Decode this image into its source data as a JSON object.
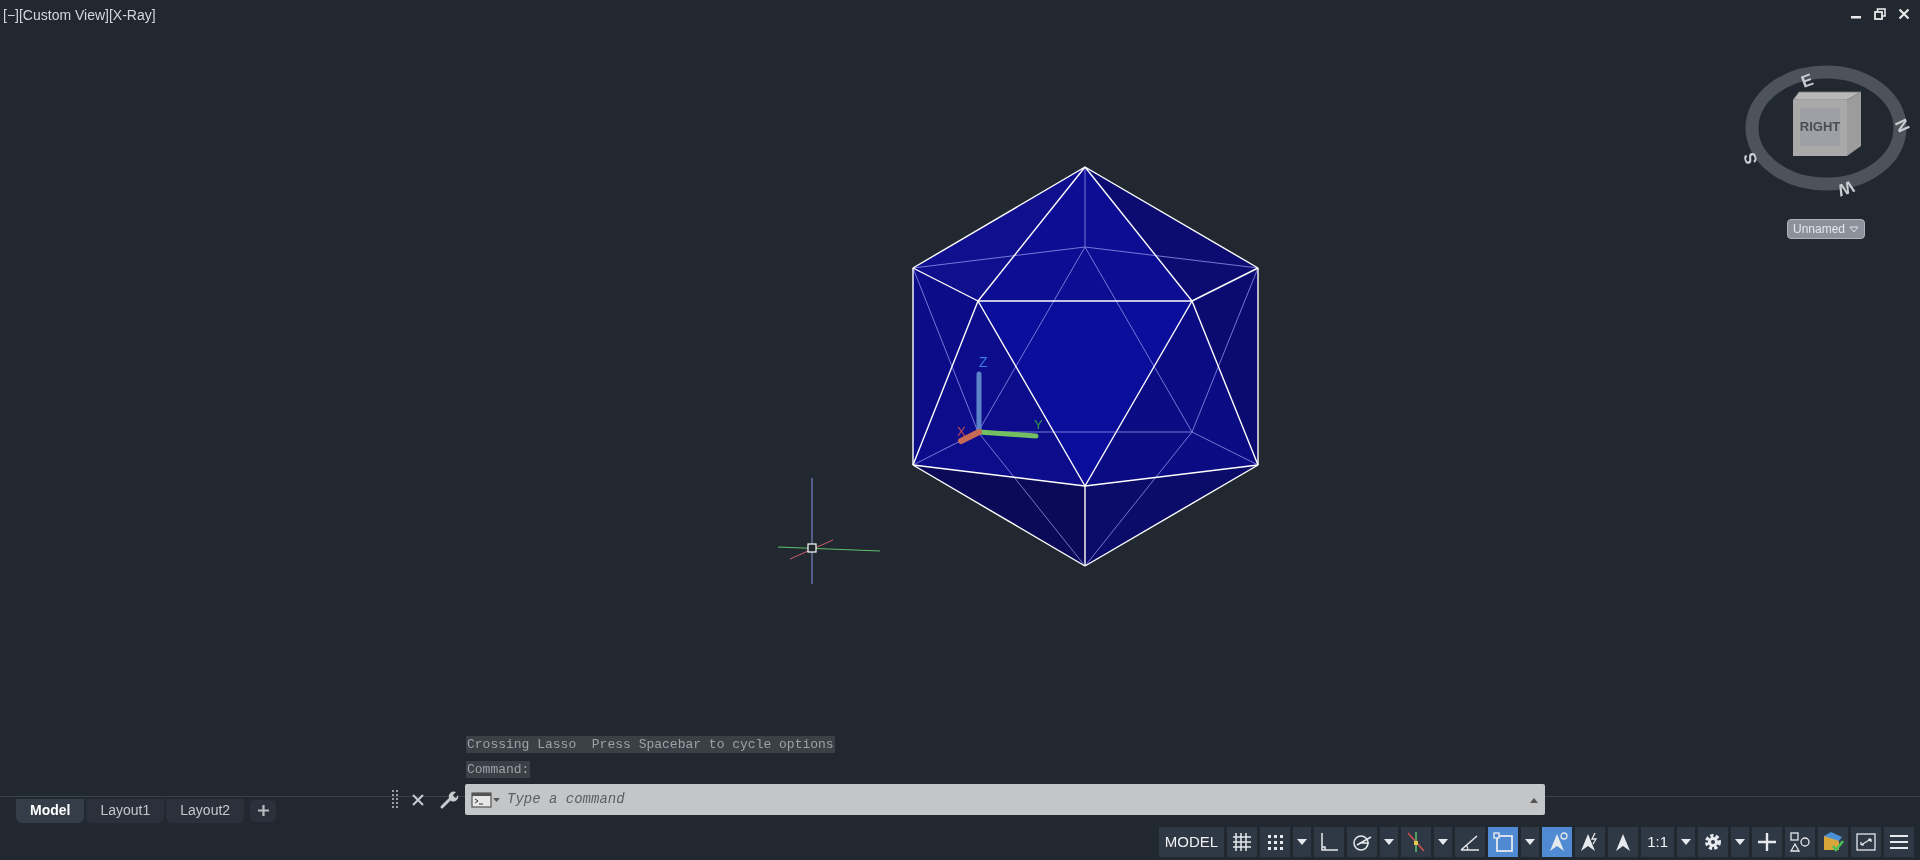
{
  "viewport": {
    "label": "[−][Custom View][X-Ray]"
  },
  "viewcube": {
    "face": "RIGHT",
    "compass": [
      "E",
      "N",
      "W",
      "S"
    ],
    "view_menu": "Unnamed"
  },
  "ucs": {
    "axes": [
      "Z",
      "Y",
      "X"
    ]
  },
  "command_line": {
    "history": [
      "Crossing Lasso  Press Spacebar to cycle options",
      "Command:"
    ],
    "placeholder": "Type a command"
  },
  "layout_tabs": [
    {
      "label": "Model",
      "selected": true
    },
    {
      "label": "Layout1",
      "selected": false
    },
    {
      "label": "Layout2",
      "selected": false
    }
  ],
  "status_bar": [
    {
      "kind": "text",
      "label": "MODEL",
      "on": false
    },
    {
      "kind": "grid",
      "on": false
    },
    {
      "kind": "snap",
      "on": false
    },
    {
      "kind": "caret",
      "on": false
    },
    {
      "kind": "ortho",
      "on": false
    },
    {
      "kind": "polar",
      "on": false
    },
    {
      "kind": "caret",
      "on": false
    },
    {
      "kind": "tracking",
      "on": false
    },
    {
      "kind": "caret",
      "on": false
    },
    {
      "kind": "angle",
      "on": false
    },
    {
      "kind": "osnap",
      "on": true
    },
    {
      "kind": "caret",
      "on": false
    },
    {
      "kind": "annotation",
      "on": true
    },
    {
      "kind": "autoscale",
      "on": false
    },
    {
      "kind": "annoscale",
      "on": false
    },
    {
      "kind": "text",
      "label": "1:1",
      "on": false
    },
    {
      "kind": "caret",
      "on": false
    },
    {
      "kind": "gear",
      "on": false
    },
    {
      "kind": "caret",
      "on": false
    },
    {
      "kind": "plus",
      "on": false
    },
    {
      "kind": "isolate",
      "on": false
    },
    {
      "kind": "hardware",
      "on": false
    },
    {
      "kind": "fullscreen",
      "on": false
    },
    {
      "kind": "menu",
      "on": false
    }
  ]
}
